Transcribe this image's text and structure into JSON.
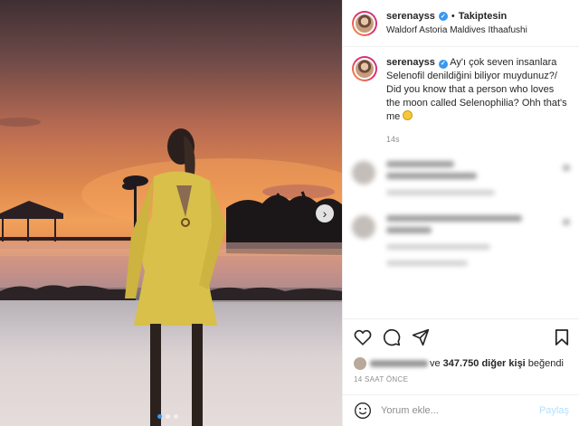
{
  "post": {
    "username": "serenayss",
    "follow_separator": "•",
    "follow_status": "Takiptesin",
    "location": "Waldorf Astoria Maldives Ithaafushi",
    "caption_text": "Ay'ı çok seven insanlara Selenofil denildiğini biliyor muydunuz?/ Did you know that a person who loves the moon called Selenophilia? Ohh that's me",
    "caption_time": "14s",
    "likes_suffix": "ve",
    "likes_count": "347.750 diğer kişi",
    "likes_end": "beğendi",
    "post_time": "14 SAAT ÖNCE"
  },
  "comment_box": {
    "placeholder": "Yorum ekle...",
    "share_label": "Paylaş"
  },
  "carousel": {
    "next_icon": "chevron-right-icon",
    "slides": 3,
    "active": 1
  },
  "colors": {
    "accent": "#3897f0",
    "verified": "#3897f0",
    "share_disabled": "#b2dffc"
  }
}
